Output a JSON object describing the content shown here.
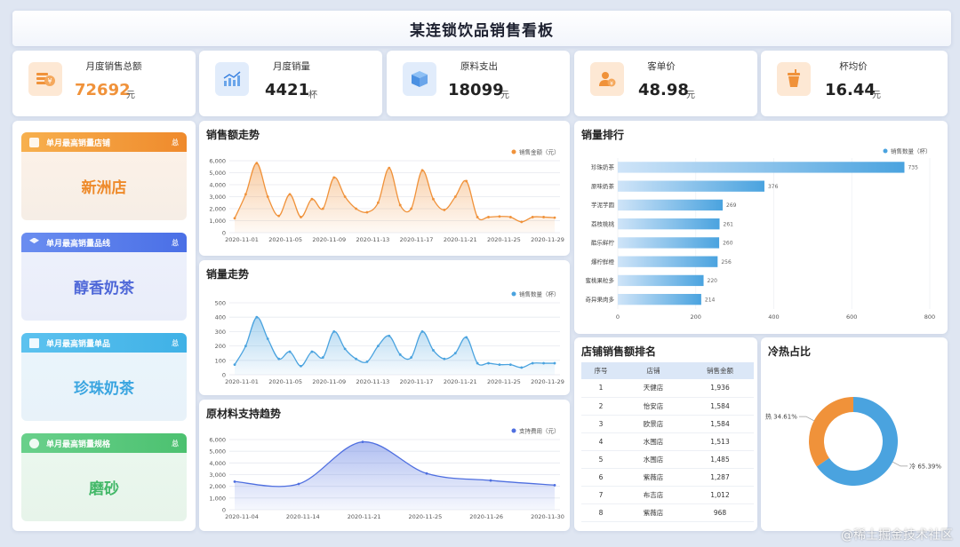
{
  "page_title": "某连锁饮品销售看板",
  "kpis": [
    {
      "label": "月度销售总额",
      "value": "72692",
      "unit": "元",
      "icon": "money-icon",
      "color": "#f0923a"
    },
    {
      "label": "月度销量",
      "value": "4421",
      "unit": "杯",
      "icon": "trend-chart-icon",
      "color": "#222"
    },
    {
      "label": "原料支出",
      "value": "18099",
      "unit": "元",
      "icon": "box-icon",
      "color": "#222"
    },
    {
      "label": "客单价",
      "value": "48.98",
      "unit": "元",
      "icon": "customer-icon",
      "color": "#222"
    },
    {
      "label": "杯均价",
      "value": "16.44",
      "unit": "元",
      "icon": "cup-icon",
      "color": "#222"
    }
  ],
  "highlights": [
    {
      "title": "单月最高销量店铺",
      "value": "新洲店",
      "tail": "总",
      "color": "#ef8a2c",
      "text_color": "#ee8a2a"
    },
    {
      "title": "单月最高销量品线",
      "value": "醇香奶茶",
      "tail": "总",
      "color": "#4a6fe6",
      "text_color": "#4f68d8"
    },
    {
      "title": "单月最高销量单品",
      "value": "珍珠奶茶",
      "tail": "总",
      "color": "#3fb1e6",
      "text_color": "#3aa5e0"
    },
    {
      "title": "单月最高销量规格",
      "value": "磨砂",
      "tail": "总",
      "color": "#4cc170",
      "text_color": "#43b868"
    }
  ],
  "sections": {
    "sales_trend": "销售额走势",
    "volume_trend": "销量走势",
    "material_trend": "原材料支持趋势",
    "ranking": "销量排行",
    "store_ranking": "店铺销售额排名",
    "hot_cold": "冷热占比"
  },
  "chart_data": [
    {
      "id": "sales_trend",
      "type": "area",
      "legend": "销售金额（元）",
      "color": "#f0923a",
      "x_ticks": [
        "2020-11-01",
        "2020-11-05",
        "2020-11-09",
        "2020-11-13",
        "2020-11-17",
        "2020-11-21",
        "2020-11-25",
        "2020-11-29"
      ],
      "y_ticks": [
        "6,000",
        "5,000",
        "4,000",
        "3,000",
        "2,000",
        "1,000",
        "0"
      ],
      "ylim": [
        0,
        6000
      ],
      "values": [
        1200,
        3200,
        5800,
        3000,
        1400,
        3200,
        1300,
        2800,
        2000,
        4600,
        3000,
        2000,
        1700,
        2500,
        5400,
        2300,
        2000,
        5200,
        2800,
        1900,
        3000,
        4300,
        1300,
        1300,
        1350,
        1300,
        900,
        1300,
        1300,
        1250
      ]
    },
    {
      "id": "volume_trend",
      "type": "area",
      "legend": "销售数量（杯）",
      "color": "#4aa3df",
      "x_ticks": [
        "2020-11-01",
        "2020-11-05",
        "2020-11-09",
        "2020-11-13",
        "2020-11-17",
        "2020-11-21",
        "2020-11-25",
        "2020-11-29"
      ],
      "y_ticks": [
        "500",
        "400",
        "300",
        "200",
        "100",
        "0"
      ],
      "ylim": [
        0,
        500
      ],
      "values": [
        70,
        200,
        400,
        250,
        110,
        160,
        60,
        160,
        120,
        300,
        180,
        110,
        90,
        200,
        270,
        140,
        120,
        300,
        170,
        110,
        150,
        260,
        80,
        80,
        70,
        70,
        50,
        80,
        80,
        80
      ]
    },
    {
      "id": "material_trend",
      "type": "area",
      "legend": "支持费用（元）",
      "color": "#4f6fe0",
      "x_ticks": [
        "2020-11-04",
        "2020-11-14",
        "2020-11-21",
        "2020-11-25",
        "2020-11-26",
        "2020-11-30"
      ],
      "y_ticks": [
        "6,000",
        "5,000",
        "4,000",
        "3,000",
        "2,000",
        "1,000",
        "0"
      ],
      "ylim": [
        0,
        6000
      ],
      "values": [
        2400,
        2200,
        5800,
        3100,
        2500,
        2100
      ]
    },
    {
      "id": "ranking",
      "type": "bar",
      "legend": "销售数量（杯）",
      "categories": [
        "珍珠奶茶",
        "原味奶茶",
        "芋泥芋圆",
        "荔枝桃桃",
        "酷乐鲜柠",
        "爆柠鲜橙",
        "蜜桃果粒多",
        "奇异果肉多"
      ],
      "values": [
        735,
        376,
        269,
        261,
        260,
        256,
        220,
        214
      ],
      "x_ticks": [
        "0",
        "200",
        "400",
        "600",
        "800"
      ],
      "xlim": [
        0,
        800
      ]
    },
    {
      "id": "hot_cold",
      "type": "pie",
      "slices": [
        {
          "label": "冷 65.39%",
          "value": 65.39,
          "color": "#4aa3df"
        },
        {
          "label": "热 34.61%",
          "value": 34.61,
          "color": "#f0923a"
        }
      ]
    }
  ],
  "store_table": {
    "headers": [
      "序号",
      "店铺",
      "销售金额"
    ],
    "rows": [
      [
        "1",
        "天健店",
        "1,936"
      ],
      [
        "2",
        "怡安店",
        "1,584"
      ],
      [
        "3",
        "欧景店",
        "1,584"
      ],
      [
        "4",
        "水围店",
        "1,513"
      ],
      [
        "5",
        "水围店",
        "1,485"
      ],
      [
        "6",
        "紫薇店",
        "1,287"
      ],
      [
        "7",
        "布吉店",
        "1,012"
      ],
      [
        "8",
        "紫薇店",
        "968"
      ]
    ]
  },
  "watermark": "@稀土掘金技术社区"
}
